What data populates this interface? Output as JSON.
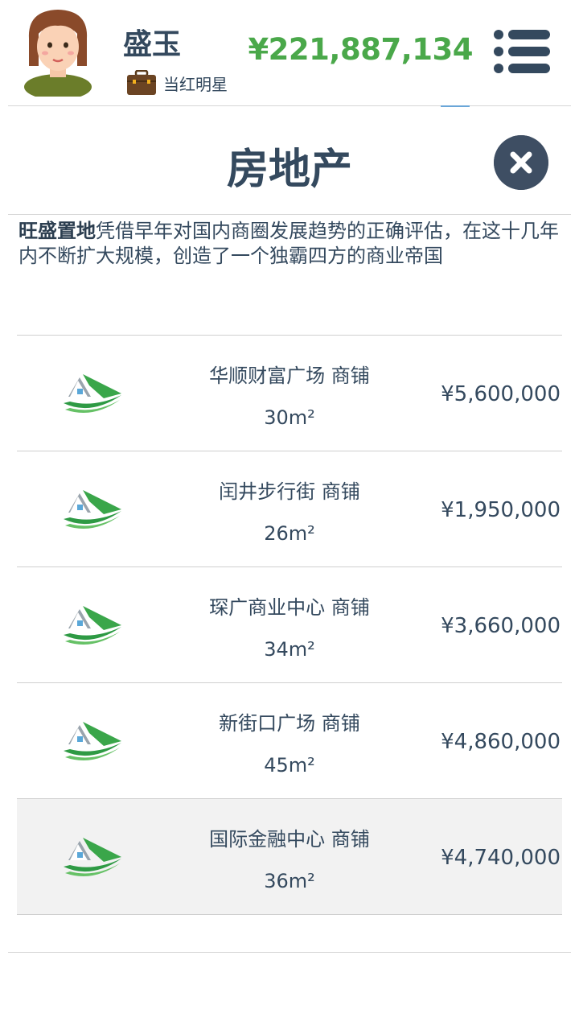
{
  "header": {
    "username": "盛玉",
    "title": "当红明星",
    "money": "¥221,887,134"
  },
  "page": {
    "title": "房地产",
    "description_bold": "旺盛置地",
    "description": "凭借早年对国内商圈发展趋势的正确评估，在这十几年内不断扩大规模，创造了一个独霸四方的商业帝国"
  },
  "properties": [
    {
      "name": "华顺财富广场 商铺",
      "area": "30m²",
      "price": "¥5,600,000"
    },
    {
      "name": "闰井步行街 商铺",
      "area": "26m²",
      "price": "¥1,950,000"
    },
    {
      "name": "琛广商业中心 商铺",
      "area": "34m²",
      "price": "¥3,660,000"
    },
    {
      "name": "新街口广场 商铺",
      "area": "45m²",
      "price": "¥4,860,000"
    },
    {
      "name": "国际金融中心 商铺",
      "area": "36m²",
      "price": "¥4,740,000",
      "selected": true
    }
  ],
  "colors": {
    "money": "#4aa84a",
    "text": "#34495e",
    "close_button": "#3e4e63",
    "house_icon": "#3aa64a"
  }
}
